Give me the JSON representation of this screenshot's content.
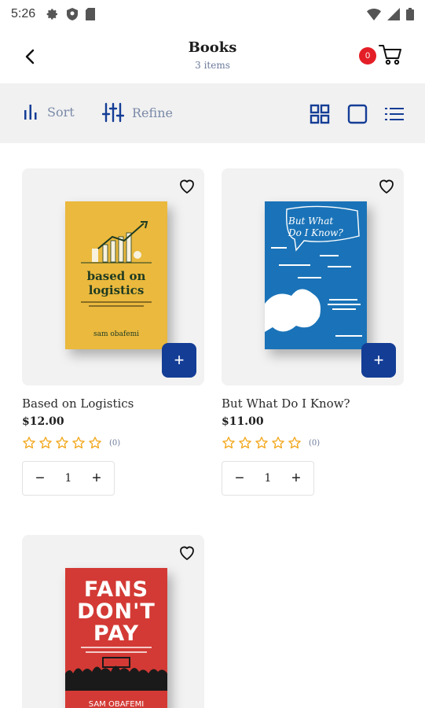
{
  "status_bar": {
    "time": "5:26",
    "icons": [
      "gear-icon",
      "shield-icon",
      "sd-card-icon",
      "wifi-icon",
      "signal-icon",
      "battery-icon"
    ]
  },
  "header": {
    "title": "Books",
    "subtitle": "3 items",
    "cart_count": "0"
  },
  "toolbar": {
    "sort_label": "Sort",
    "refine_label": "Refine",
    "views": [
      "grid-view",
      "single-view",
      "list-view"
    ],
    "active_view": "grid-view"
  },
  "colors": {
    "accent": "#143d96",
    "badge": "#e41e26",
    "star": "#f2a81d",
    "muted_text": "#6c7a99"
  },
  "products": [
    {
      "title": "Based on Logistics",
      "price": "$12.00",
      "rating_count": "(0)",
      "quantity": "1",
      "cover": {
        "title_line1": "based on",
        "title_line2": "logistics",
        "author": "sam obafemi"
      }
    },
    {
      "title": "But What Do I Know?",
      "price": "$11.00",
      "rating_count": "(0)",
      "quantity": "1",
      "cover": {
        "title_line1": "But What",
        "title_line2": "Do I Know?"
      }
    },
    {
      "cover": {
        "title_line1": "FANS",
        "title_line2": "DON'T",
        "title_line3": "PAY",
        "author": "SAM OBAFEMI"
      }
    }
  ]
}
